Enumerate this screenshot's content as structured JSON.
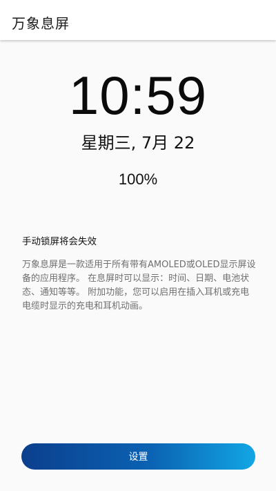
{
  "app_bar": {
    "title": "万象息屏"
  },
  "clock": {
    "time": "10:59",
    "date": "星期三, 7月 22",
    "battery": "100%"
  },
  "info": {
    "notice": "手动锁屏将会失效",
    "description": "万象息屏是一款适用于所有带有AMOLED或OLED显示屏设备的应用程序。 在息屏时可以显示：时间、日期、电池状态、通知等等。 附加功能，您可以启用在插入耳机或充电电缆时显示的充电和耳机动画。"
  },
  "actions": {
    "settings_label": "设置"
  },
  "colors": {
    "button_gradient_start": "#0b3f8d",
    "button_gradient_end": "#12a6e4",
    "background": "#fafafa"
  }
}
